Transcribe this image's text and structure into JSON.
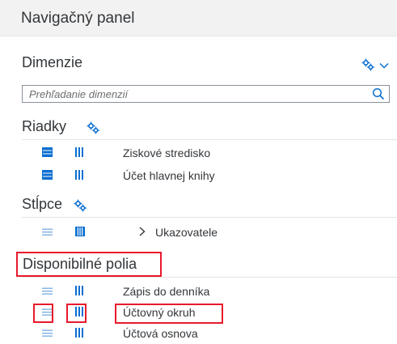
{
  "header": {
    "title": "Navigačný panel"
  },
  "dimensions": {
    "title": "Dimenzie",
    "settings_icon": "gear-icon",
    "expand_icon": "chevron-down-icon",
    "search_placeholder": "Prehľadanie dimenzií"
  },
  "rows_section": {
    "title": "Riadky",
    "items": [
      {
        "label": "Ziskové stredisko"
      },
      {
        "label": "Účet hlavnej knihy"
      }
    ]
  },
  "columns_section": {
    "title": "Stĺpce",
    "items": [
      {
        "label": "Ukazovatele",
        "expandable": true
      }
    ]
  },
  "available_section": {
    "title": "Disponibilné polia",
    "items": [
      {
        "label": "Zápis do denníka"
      },
      {
        "label": "Účtovný okruh"
      },
      {
        "label": "Účtová osnova"
      }
    ]
  },
  "colors": {
    "accent": "#0a6ed1",
    "highlight": "#e8192c",
    "header_bg": "#f2f2f2",
    "text": "#32363a"
  }
}
